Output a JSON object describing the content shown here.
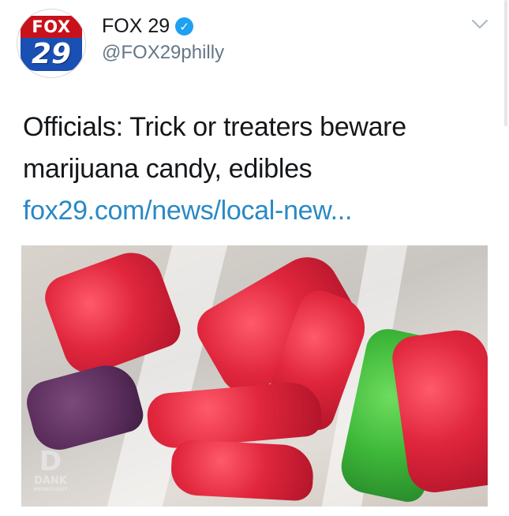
{
  "account": {
    "display_name": "FOX 29",
    "handle": "@FOX29philly",
    "verified_mark": "✓",
    "avatar_logo_top": "FOX",
    "avatar_logo_bottom": "29"
  },
  "menu": {
    "icon": "chevron-down-icon"
  },
  "tweet": {
    "text": "Officials: Trick or treaters beware marijuana candy, edibles",
    "link": "fox29.com/news/local-new..."
  },
  "media": {
    "watermark_top": "D",
    "watermark_word": "DANK",
    "watermark_sub": "MEMEOLOGY"
  },
  "colors": {
    "link": "#2a89c5",
    "verified": "#1da1f2",
    "handle": "#657786",
    "fox_red": "#c9111b",
    "fox_blue": "#1a4fb4"
  }
}
